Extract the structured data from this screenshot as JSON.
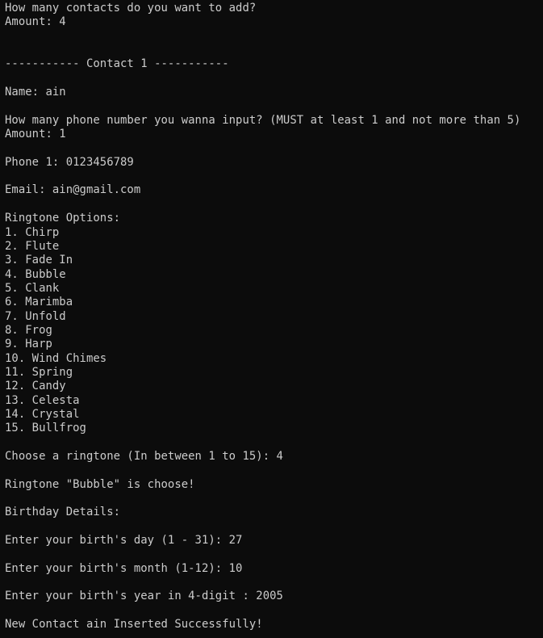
{
  "terminal": {
    "lines": [
      "How many contacts do you want to add?",
      "Amount: 4",
      "",
      "",
      "----------- Contact 1 -----------",
      "",
      "Name: ain",
      "",
      "How many phone number you wanna input? (MUST at least 1 and not more than 5)",
      "Amount: 1",
      "",
      "Phone 1: 0123456789",
      "",
      "Email: ain@gmail.com",
      "",
      "Ringtone Options:",
      "1. Chirp",
      "2. Flute",
      "3. Fade In",
      "4. Bubble",
      "5. Clank",
      "6. Marimba",
      "7. Unfold",
      "8. Frog",
      "9. Harp",
      "10. Wind Chimes",
      "11. Spring",
      "12. Candy",
      "13. Celesta",
      "14. Crystal",
      "15. Bullfrog",
      "",
      "Choose a ringtone (In between 1 to 15): 4",
      "",
      "Ringtone \"Bubble\" is choose!",
      "",
      "Birthday Details:",
      "",
      "Enter your birth's day (1 - 31): 27",
      "",
      "Enter your birth's month (1-12): 10",
      "",
      "Enter your birth's year in 4-digit : 2005",
      "",
      "New Contact ain Inserted Successfully!"
    ]
  },
  "colors": {
    "background": "#0c0c0c",
    "text": "#cccccc"
  }
}
